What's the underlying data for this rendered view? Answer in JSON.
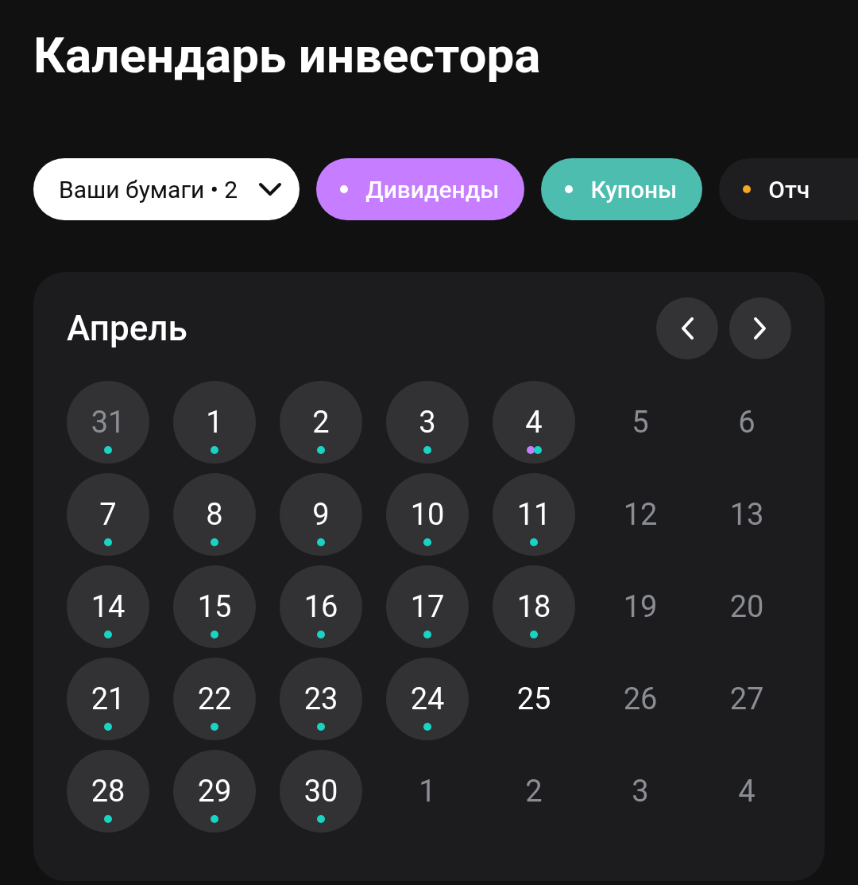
{
  "title": "Календарь инвестора",
  "filters": [
    {
      "kind": "dropdown",
      "label": "Ваши бумаги • 2",
      "selected": true
    },
    {
      "kind": "tag",
      "label": "Дивиденды",
      "color": "#c77dff",
      "selected": true
    },
    {
      "kind": "tag",
      "label": "Купоны",
      "color": "#4dbdb0",
      "selected": true
    },
    {
      "kind": "tag",
      "label": "Отч",
      "color": "#f5a623",
      "selected": false
    }
  ],
  "calendar": {
    "month": "Апрель",
    "days": [
      {
        "text": "31",
        "muted": true,
        "events": [
          {
            "color": "#19d3c5"
          }
        ]
      },
      {
        "text": "1",
        "muted": false,
        "events": [
          {
            "color": "#19d3c5"
          }
        ]
      },
      {
        "text": "2",
        "muted": false,
        "events": [
          {
            "color": "#19d3c5"
          }
        ]
      },
      {
        "text": "3",
        "muted": false,
        "events": [
          {
            "color": "#19d3c5"
          }
        ]
      },
      {
        "text": "4",
        "muted": false,
        "events": [
          {
            "color": "#c77dff"
          },
          {
            "color": "#19d3c5"
          }
        ]
      },
      {
        "text": "5",
        "muted": true
      },
      {
        "text": "6",
        "muted": true
      },
      {
        "text": "7",
        "muted": false,
        "events": [
          {
            "color": "#19d3c5"
          }
        ]
      },
      {
        "text": "8",
        "muted": false,
        "events": [
          {
            "color": "#19d3c5"
          }
        ]
      },
      {
        "text": "9",
        "muted": false,
        "events": [
          {
            "color": "#19d3c5"
          }
        ]
      },
      {
        "text": "10",
        "muted": false,
        "events": [
          {
            "color": "#19d3c5"
          }
        ]
      },
      {
        "text": "11",
        "muted": false,
        "events": [
          {
            "color": "#19d3c5"
          }
        ]
      },
      {
        "text": "12",
        "muted": true
      },
      {
        "text": "13",
        "muted": true
      },
      {
        "text": "14",
        "muted": false,
        "events": [
          {
            "color": "#19d3c5"
          }
        ]
      },
      {
        "text": "15",
        "muted": false,
        "events": [
          {
            "color": "#19d3c5"
          }
        ]
      },
      {
        "text": "16",
        "muted": false,
        "events": [
          {
            "color": "#19d3c5"
          }
        ]
      },
      {
        "text": "17",
        "muted": false,
        "events": [
          {
            "color": "#19d3c5"
          }
        ]
      },
      {
        "text": "18",
        "muted": false,
        "events": [
          {
            "color": "#19d3c5"
          }
        ]
      },
      {
        "text": "19",
        "muted": true
      },
      {
        "text": "20",
        "muted": true
      },
      {
        "text": "21",
        "muted": false,
        "events": [
          {
            "color": "#19d3c5"
          }
        ]
      },
      {
        "text": "22",
        "muted": false,
        "events": [
          {
            "color": "#19d3c5"
          }
        ]
      },
      {
        "text": "23",
        "muted": false,
        "events": [
          {
            "color": "#19d3c5"
          }
        ]
      },
      {
        "text": "24",
        "muted": false,
        "events": [
          {
            "color": "#19d3c5"
          }
        ]
      },
      {
        "text": "25",
        "muted": false
      },
      {
        "text": "26",
        "muted": true
      },
      {
        "text": "27",
        "muted": true
      },
      {
        "text": "28",
        "muted": false,
        "events": [
          {
            "color": "#19d3c5"
          }
        ]
      },
      {
        "text": "29",
        "muted": false,
        "events": [
          {
            "color": "#19d3c5"
          }
        ]
      },
      {
        "text": "30",
        "muted": false,
        "events": [
          {
            "color": "#19d3c5"
          }
        ]
      },
      {
        "text": "1",
        "muted": true
      },
      {
        "text": "2",
        "muted": true
      },
      {
        "text": "3",
        "muted": true
      },
      {
        "text": "4",
        "muted": true
      }
    ]
  }
}
